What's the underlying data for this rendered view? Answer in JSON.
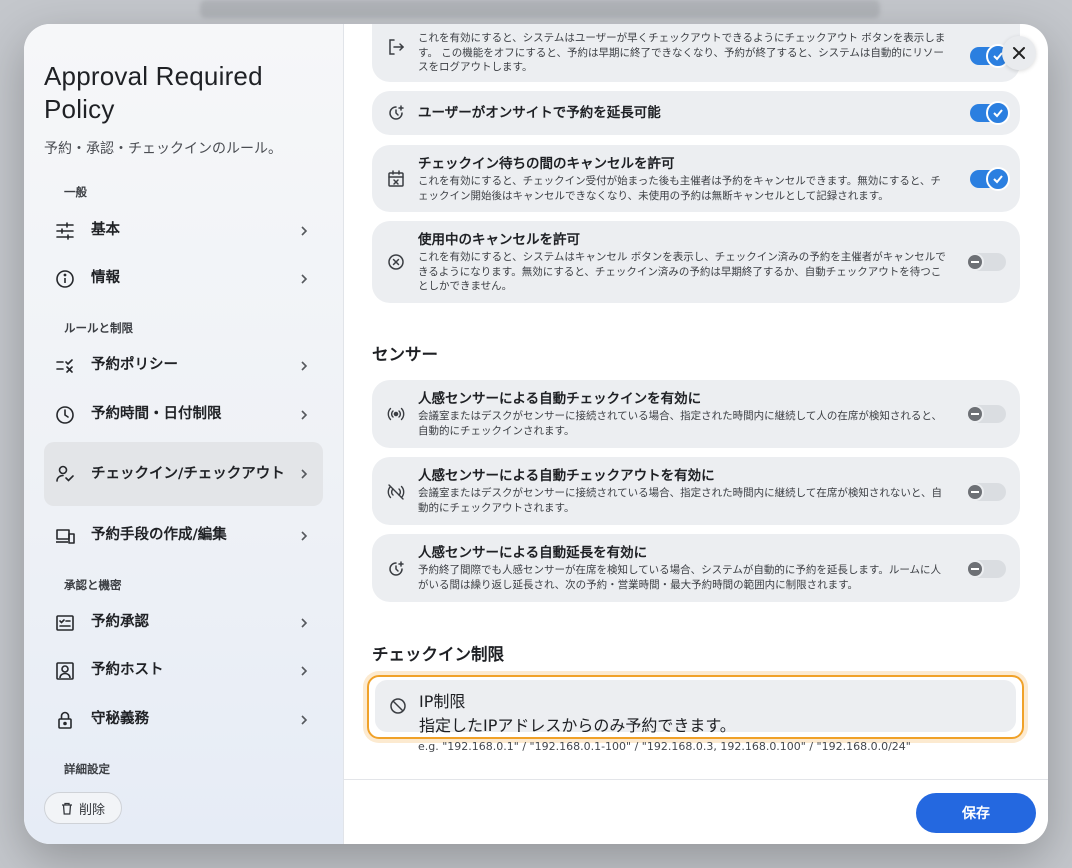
{
  "modal": {
    "title": "Approval Required Policy",
    "subtitle": "予約・承認・チェックインのルール。",
    "close_icon": "close-icon"
  },
  "sidebar": {
    "sections": [
      {
        "label": "一般"
      },
      {
        "label": "ルールと制限"
      },
      {
        "label": "承認と機密"
      },
      {
        "label": "詳細設定"
      }
    ],
    "items": [
      {
        "label": "基本",
        "icon": "sliders-icon"
      },
      {
        "label": "情報",
        "icon": "info-icon"
      },
      {
        "label": "予約ポリシー",
        "icon": "checklist-icon"
      },
      {
        "label": "予約時間・日付制限",
        "icon": "clock-icon"
      },
      {
        "label": "チェックイン/チェックアウト",
        "icon": "person-check-icon",
        "active": true
      },
      {
        "label": "予約手段の作成/編集",
        "icon": "devices-icon"
      },
      {
        "label": "予約承認",
        "icon": "approval-icon"
      },
      {
        "label": "予約ホスト",
        "icon": "host-icon"
      },
      {
        "label": "守秘義務",
        "icon": "lock-icon"
      }
    ],
    "delete_label": "削除"
  },
  "main": {
    "cards": [
      {
        "title": "",
        "desc": "これを有効にすると、システムはユーザーが早くチェックアウトできるようにチェックアウト ボタンを表示します。 この機能をオフにすると、予約は早期に終了できなくなり、予約が終了すると、システムは自動的にリソースをログアウトします。",
        "on": true,
        "icon": "logout-icon"
      },
      {
        "title": "ユーザーがオンサイトで予約を延長可能",
        "desc": "",
        "on": true,
        "icon": "extend-time-icon"
      },
      {
        "title": "チェックイン待ちの間のキャンセルを許可",
        "desc": "これを有効にすると、チェックイン受付が始まった後も主催者は予約をキャンセルできます。無効にすると、チェックイン開始後はキャンセルできなくなり、未使用の予約は無断キャンセルとして記録されます。",
        "on": true,
        "icon": "calendar-x-icon"
      },
      {
        "title": "使用中のキャンセルを許可",
        "desc": "これを有効にすると、システムはキャンセル ボタンを表示し、チェックイン済みの予約を主催者がキャンセルできるようになります。無効にすると、チェックイン済みの予約は早期終了するか、自動チェックアウトを待つことしかできません。",
        "on": false,
        "icon": "circle-x-icon"
      }
    ],
    "sensor_heading": "センサー",
    "sensor_cards": [
      {
        "title": "人感センサーによる自動チェックインを有効に",
        "desc": "会議室またはデスクがセンサーに接続されている場合、指定された時間内に継続して人の在席が検知されると、自動的にチェックインされます。",
        "on": false,
        "icon": "sensor-icon"
      },
      {
        "title": "人感センサーによる自動チェックアウトを有効に",
        "desc": "会議室またはデスクがセンサーに接続されている場合、指定された時間内に継続して在席が検知されないと、自動的にチェックアウトされます。",
        "on": false,
        "icon": "sensor-off-icon"
      },
      {
        "title": "人感センサーによる自動延長を有効に",
        "desc": "予約終了間際でも人感センサーが在席を検知している場合、システムが自動的に予約を延長します。ルームに人がいる間は繰り返し延長され、次の予約・営業時間・最大予約時間の範囲内に制限されます。",
        "on": false,
        "icon": "extend-time-icon"
      }
    ],
    "checkin_heading": "チェックイン制限",
    "ip": {
      "title": "IP制限",
      "desc": "指定したIPアドレスからのみ予約できます。",
      "hint": "e.g. \"192.168.0.1\" / \"192.168.0.1-100\" / \"192.168.0.3, 192.168.0.100\" / \"192.168.0.0/24\"",
      "icon": "block-icon"
    }
  },
  "footer": {
    "save_label": "保存"
  },
  "colors": {
    "accent": "#2b7fe0",
    "save": "#2468e0",
    "focus": "#f0a128"
  }
}
